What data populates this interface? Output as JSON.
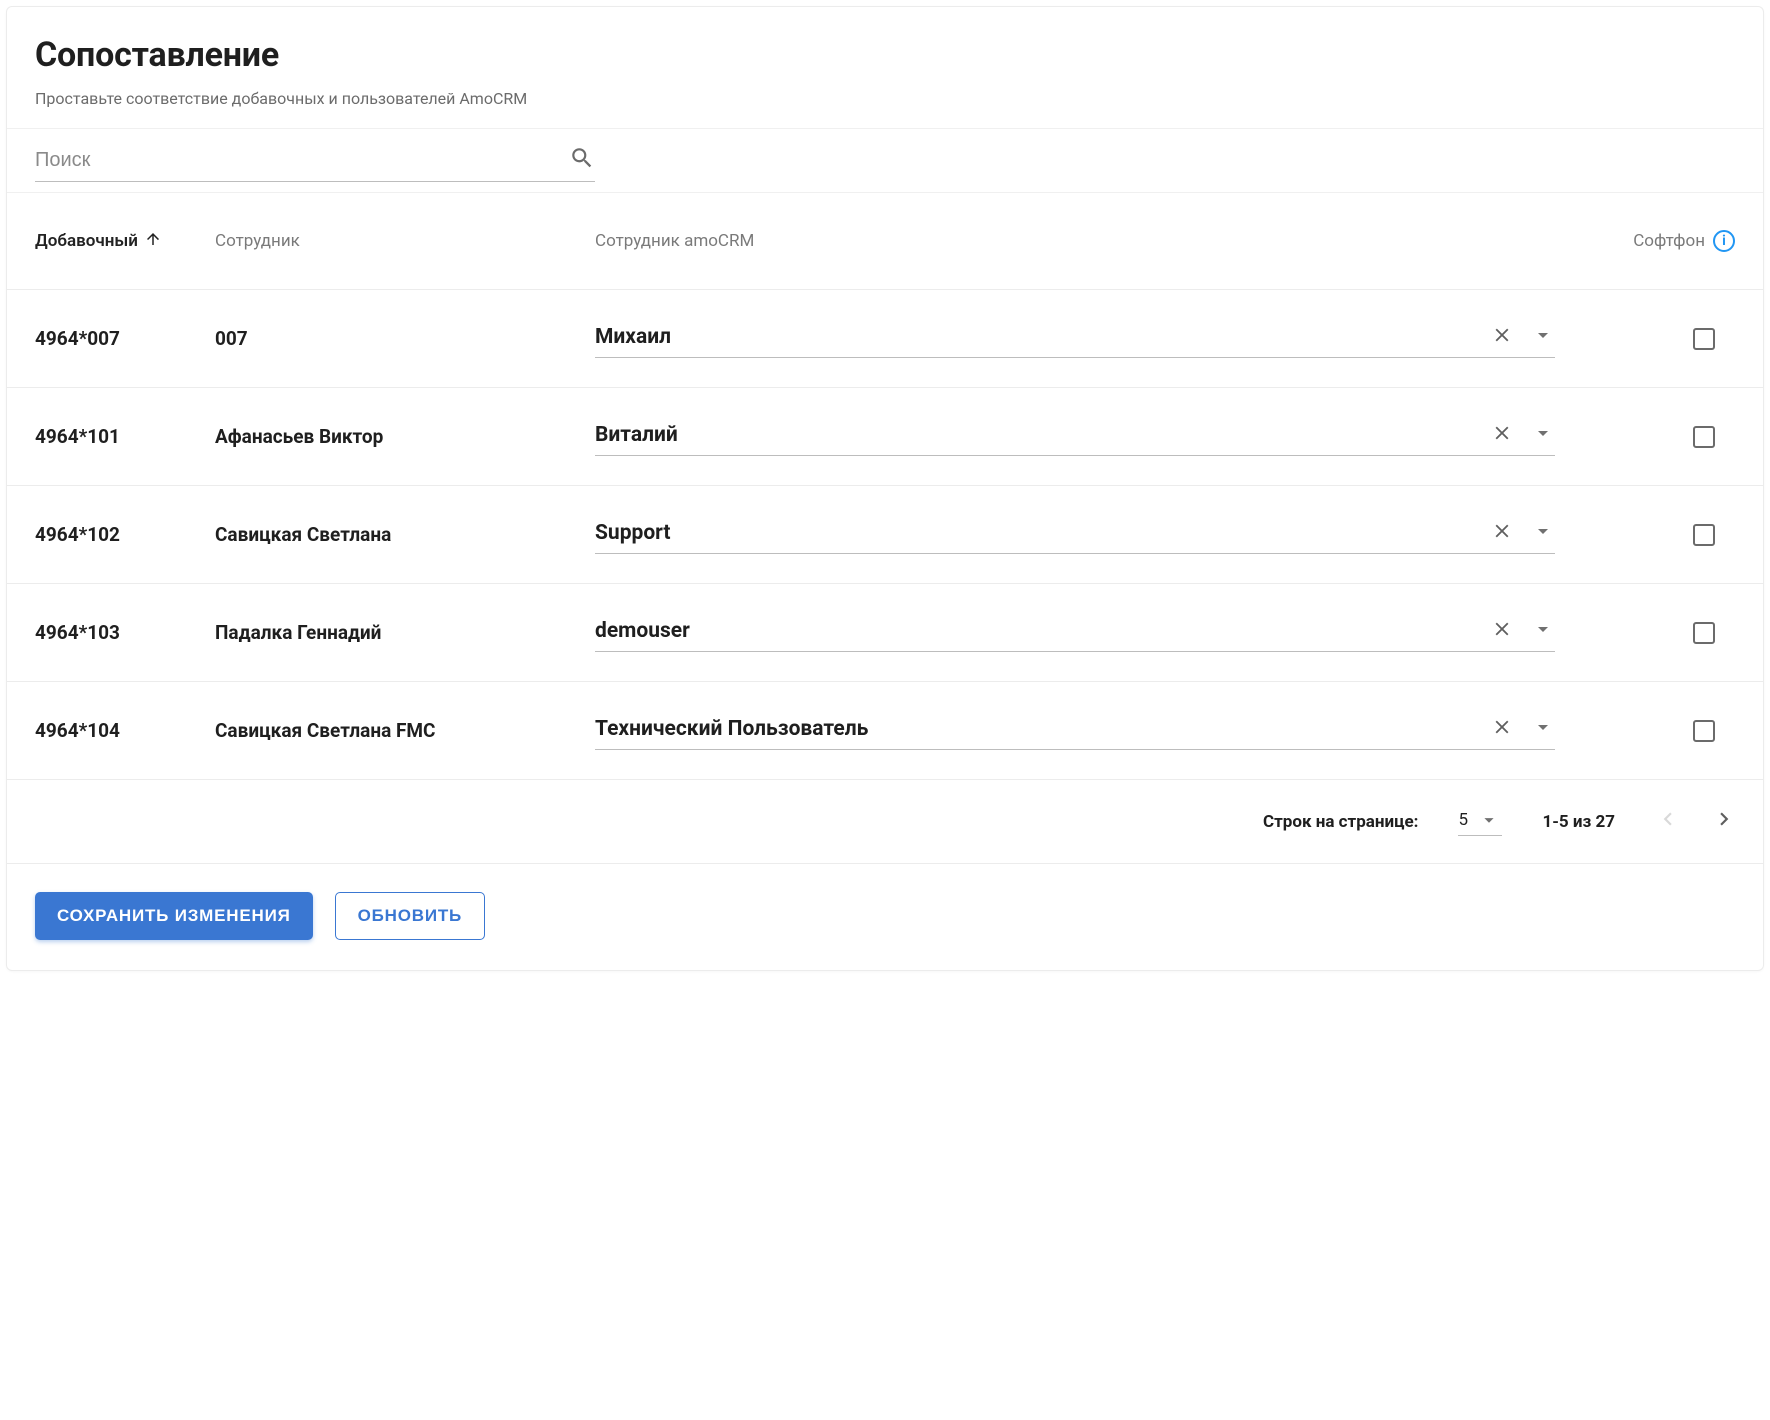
{
  "header": {
    "title": "Сопоставление",
    "subtitle": "Проставьте соответствие добавочных и пользователей AmoCRM"
  },
  "search": {
    "placeholder": "Поиск"
  },
  "columns": {
    "extension": "Добавочный",
    "employee": "Сотрудник",
    "amocrm": "Сотрудник amoCRM",
    "softphone": "Софтфон"
  },
  "rows": [
    {
      "extension": "4964*007",
      "employee": "007",
      "amocrm_user": "Михаил",
      "softphone": false
    },
    {
      "extension": "4964*101",
      "employee": "Афанасьев Виктор",
      "amocrm_user": "Виталий",
      "softphone": false
    },
    {
      "extension": "4964*102",
      "employee": "Савицкая Светлана",
      "amocrm_user": "Support",
      "softphone": false
    },
    {
      "extension": "4964*103",
      "employee": "Падалка Геннадий",
      "amocrm_user": "demouser",
      "softphone": false
    },
    {
      "extension": "4964*104",
      "employee": "Савицкая Светлана FMC",
      "amocrm_user": "Технический Пользователь",
      "softphone": false
    }
  ],
  "pagination": {
    "rows_per_page_label": "Строк на странице:",
    "rows_per_page_value": "5",
    "range_text": "1-5 из 27"
  },
  "buttons": {
    "save": "СОХРАНИТЬ ИЗМЕНЕНИЯ",
    "refresh": "ОБНОВИТЬ"
  }
}
